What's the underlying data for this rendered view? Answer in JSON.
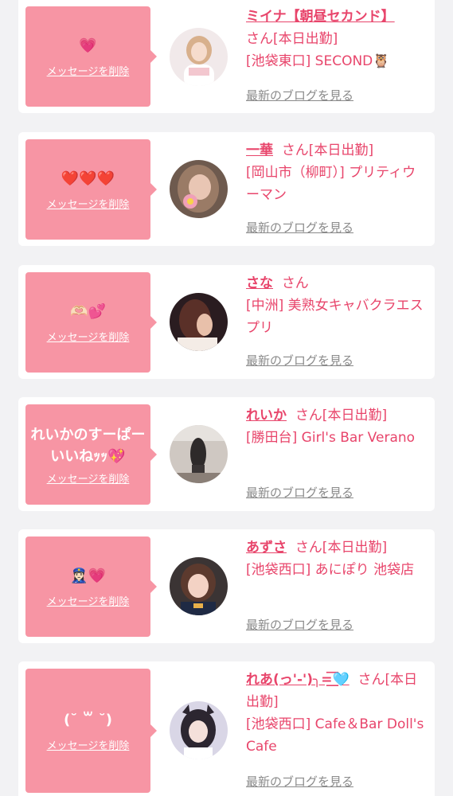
{
  "colors": {
    "background": "#f2f2f4",
    "card": "#ffffff",
    "bubble": "#f795a4",
    "accent": "#e8456b",
    "link_gray": "#8a8a8a"
  },
  "delete_label": "メッセージを削除",
  "blog_label": "最新のブログを見る",
  "items": [
    {
      "message": "💗",
      "name": "ミイナ【朝昼セカンド】",
      "suffix": "さん[本日出勤]",
      "shop": "[池袋東口] SECOND🦉",
      "avatar_icon": "profile-photo"
    },
    {
      "message": "❤️❤️❤️",
      "name": "一華",
      "suffix": "さん[本日出勤]",
      "shop": "[岡山市（柳町）] プリティウーマン",
      "avatar_icon": "profile-photo"
    },
    {
      "message": "🫶🏻💕",
      "name": "さな",
      "suffix": "さん",
      "shop": "[中洲] 美熟女キャバクラエスプリ",
      "avatar_icon": "profile-photo"
    },
    {
      "message": "れいかのすーぱーいいねｯｯ💖",
      "name": "れいか",
      "suffix": "さん[本日出勤]",
      "shop": "[勝田台] Girl's Bar Verano",
      "avatar_icon": "profile-photo"
    },
    {
      "message": "👮🏻‍♀️💗",
      "name": "あずさ",
      "suffix": "さん[本日出勤]",
      "shop": "[池袋西口] あにぽり 池袋店",
      "avatar_icon": "profile-photo"
    },
    {
      "message": "(˘ ꒳ ˘)",
      "name": "れあ(っ'-')╮=͟͟͞͞🩵",
      "suffix": "さん[本日出勤]",
      "shop": "[池袋西口] Cafe＆Bar Doll's Cafe",
      "avatar_icon": "profile-photo"
    }
  ]
}
